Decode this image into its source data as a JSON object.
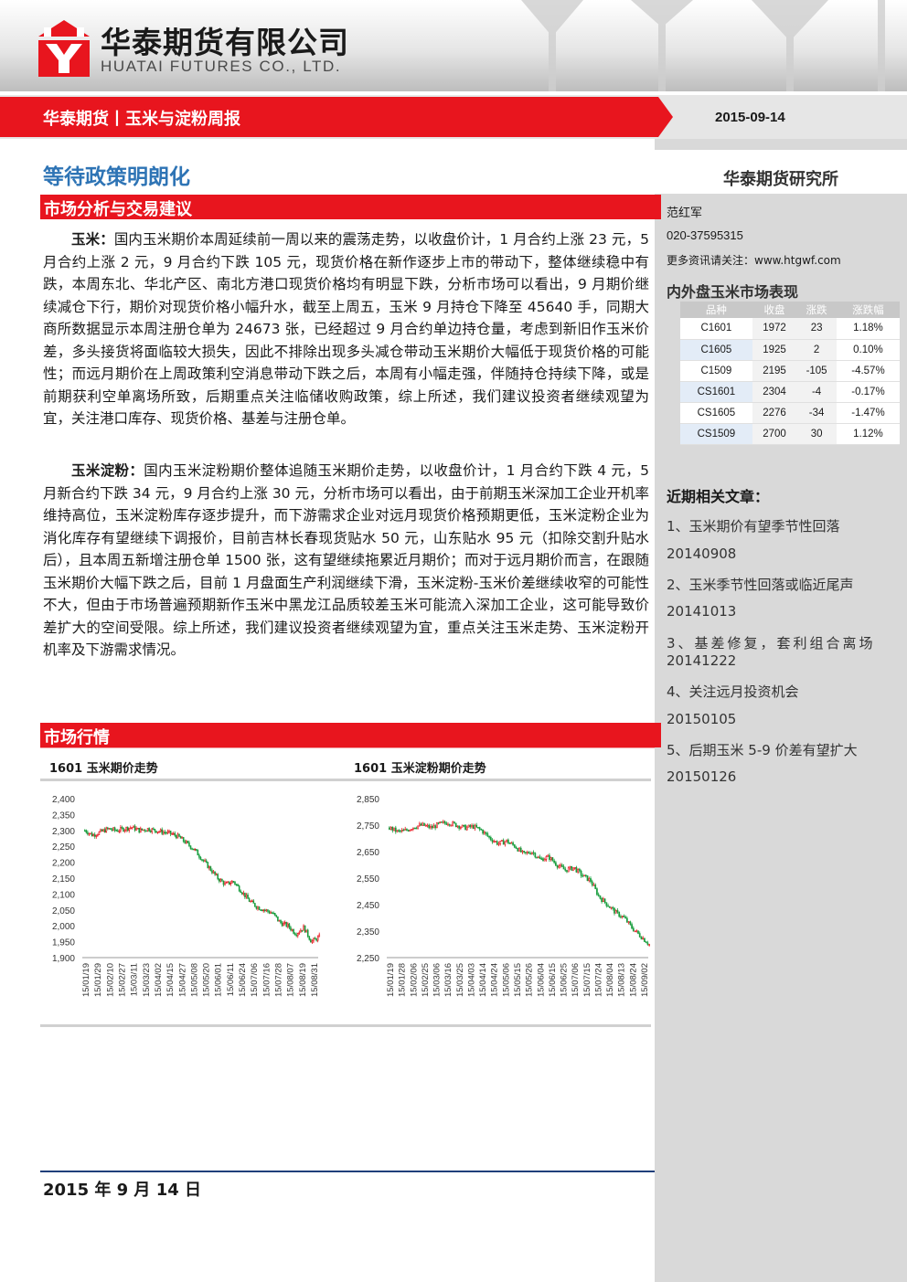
{
  "header": {
    "company_cn": "华泰期货有限公司",
    "company_en": "HUATAI FUTURES CO., LTD.",
    "report_series": "华泰期货丨玉米与淀粉周报",
    "date": "2015-09-14",
    "brand_red": "#e8151e"
  },
  "main": {
    "title": "等待政策明朗化",
    "section1": "市场分析与交易建议",
    "para1_lead": "玉米：",
    "para1_body": "国内玉米期价本周延续前一周以来的震荡走势，以收盘价计，1 月合约上涨 23 元，5 月合约上涨 2 元，9 月合约下跌 105 元，现货价格在新作逐步上市的带动下，整体继续稳中有跌，本周东北、华北产区、南北方港口现货价格均有明显下跌，分析市场可以看出，9 月期价继续减仓下行，期价对现货价格小幅升水，截至上周五，玉米 9 月持仓下降至 45640 手，同期大商所数据显示本周注册仓单为 24673 张，已经超过 9 月合约单边持仓量，考虑到新旧作玉米价差，多头接货将面临较大损失，因此不排除出现多头减仓带动玉米期价大幅低于现货价格的可能性；而远月期价在上周政策利空消息带动下跌之后，本周有小幅走强，伴随持仓持续下降，或是前期获利空单离场所致，后期重点关注临储收购政策，综上所述，我们建议投资者继续观望为宜，关注港口库存、现货价格、基差与注册仓单。",
    "para2_lead": "玉米淀粉：",
    "para2_body": "国内玉米淀粉期价整体追随玉米期价走势，以收盘价计，1 月合约下跌 4 元，5 月新合约下跌 34 元，9 月合约上涨 30 元，分析市场可以看出，由于前期玉米深加工企业开机率维持高位，玉米淀粉库存逐步提升，而下游需求企业对远月现货价格预期更低，玉米淀粉企业为消化库存有望继续下调报价，目前吉林长春现货贴水 50 元，山东贴水 95 元（扣除交割升贴水后），且本周五新增注册仓单 1500 张，这有望继续拖累近月期价；而对于远月期价而言，在跟随玉米期价大幅下跌之后，目前 1 月盘面生产利润继续下滑，玉米淀粉-玉米价差继续收窄的可能性不大，但由于市场普遍预期新作玉米中黑龙江品质较差玉米可能流入深加工企业，这可能导致价差扩大的空间受限。综上所述，我们建议投资者继续观望为宜，重点关注玉米走势、玉米淀粉开机率及下游需求情况。",
    "section2": "市场行情"
  },
  "sidebar": {
    "institute": "华泰期货研究所",
    "author": "范红军",
    "phone": "020-37595315",
    "more_info": "更多资讯请关注：www.htgwf.com",
    "table_title": "内外盘玉米市场表现",
    "table_headers": [
      "品种",
      "收盘",
      "涨跌",
      "涨跌幅"
    ],
    "table_rows": [
      [
        "C1601",
        "1972",
        "23",
        "1.18%"
      ],
      [
        "C1605",
        "1925",
        "2",
        "0.10%"
      ],
      [
        "C1509",
        "2195",
        "-105",
        "-4.57%"
      ],
      [
        "CS1601",
        "2304",
        "-4",
        "-0.17%"
      ],
      [
        "CS1605",
        "2276",
        "-34",
        "-1.47%"
      ],
      [
        "CS1509",
        "2700",
        "30",
        "1.12%"
      ]
    ],
    "related_title": "近期相关文章：",
    "related": [
      {
        "title": "1、玉米期价有望季节性回落",
        "date": "20140908"
      },
      {
        "title": "2、玉米季节性回落或临近尾声",
        "date": "20141013"
      },
      {
        "title": "3、基差修复，套利组合离场",
        "date": "20141222"
      },
      {
        "title": "4、关注远月投资机会",
        "date": "20150105"
      },
      {
        "title": "5、后期玉米 5-9 价差有望扩大",
        "date": "20150126"
      }
    ]
  },
  "footer": {
    "date": "2015 年 9 月 14 日"
  },
  "chart_data": [
    {
      "type": "candlestick",
      "title": "1601 玉米期价走势",
      "ylim": [
        1900,
        2400
      ],
      "yticks": [
        "1,900",
        "1,950",
        "2,000",
        "2,050",
        "2,100",
        "2,150",
        "2,200",
        "2,250",
        "2,300",
        "2,350",
        "2,400"
      ],
      "x_ticks": [
        "15/01/19",
        "15/01/29",
        "15/02/10",
        "15/02/27",
        "15/03/11",
        "15/03/23",
        "15/04/02",
        "15/04/15",
        "15/04/27",
        "15/05/08",
        "15/05/20",
        "15/06/01",
        "15/06/11",
        "15/06/24",
        "15/07/06",
        "15/07/16",
        "15/07/28",
        "15/08/07",
        "15/08/19",
        "15/08/31"
      ],
      "close_path": [
        2300,
        2285,
        2295,
        2305,
        2300,
        2305,
        2310,
        2300,
        2305,
        2300,
        2295,
        2290,
        2280,
        2260,
        2240,
        2210,
        2180,
        2150,
        2130,
        2140,
        2110,
        2080,
        2060,
        2050,
        2040,
        2010,
        2000,
        1975,
        1995,
        1950,
        1965
      ]
    },
    {
      "type": "candlestick",
      "title": "1601 玉米淀粉期价走势",
      "ylim": [
        2250,
        2850
      ],
      "yticks": [
        "2,250",
        "2,350",
        "2,450",
        "2,550",
        "2,650",
        "2,750",
        "2,850"
      ],
      "x_ticks": [
        "15/01/19",
        "15/01/28",
        "15/02/06",
        "15/02/25",
        "15/03/06",
        "15/03/16",
        "15/03/25",
        "15/04/03",
        "15/04/14",
        "15/04/24",
        "15/05/06",
        "15/05/15",
        "15/05/26",
        "15/06/04",
        "15/06/15",
        "15/06/25",
        "15/07/06",
        "15/07/15",
        "15/07/24",
        "15/08/04",
        "15/08/13",
        "15/08/24",
        "15/09/02"
      ],
      "close_path": [
        2740,
        2725,
        2730,
        2745,
        2750,
        2740,
        2755,
        2760,
        2750,
        2740,
        2745,
        2730,
        2700,
        2680,
        2690,
        2670,
        2640,
        2650,
        2620,
        2630,
        2600,
        2580,
        2590,
        2560,
        2540,
        2480,
        2450,
        2420,
        2400,
        2360,
        2330,
        2300
      ]
    }
  ]
}
